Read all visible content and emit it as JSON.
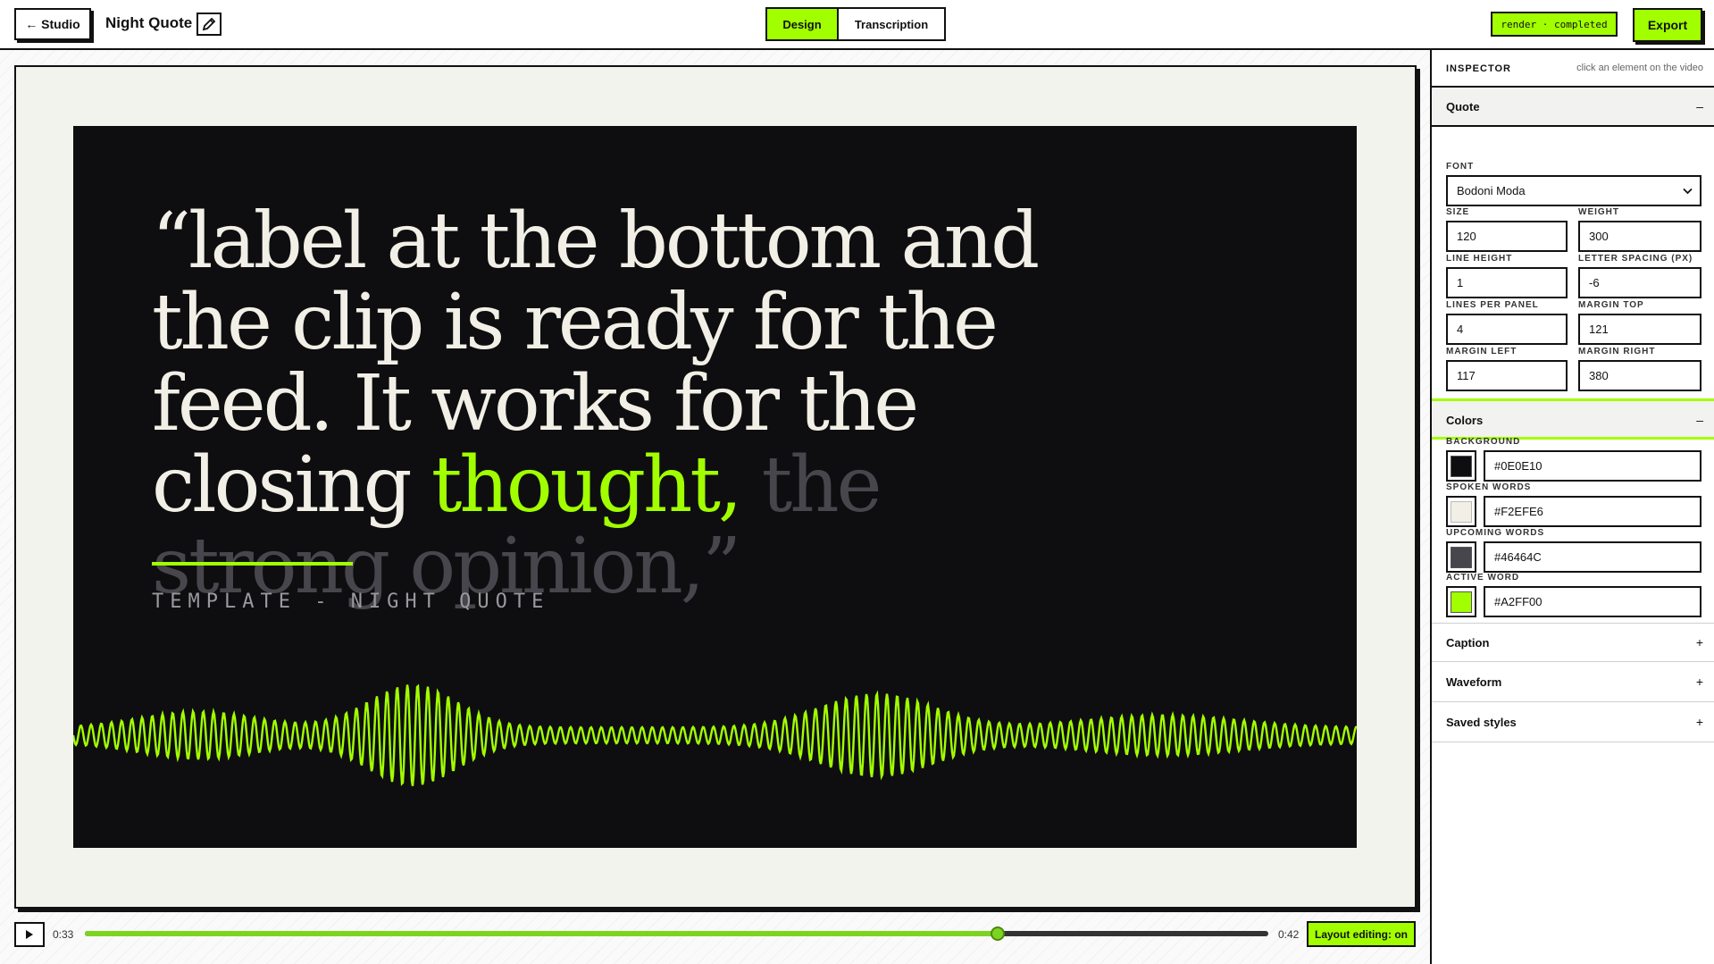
{
  "topbar": {
    "back_label": "← Studio",
    "project_name": "Night Quote",
    "modes": [
      "Design",
      "Transcription"
    ],
    "active_mode": "Design",
    "render_status": "render · completed",
    "export_label": "Export"
  },
  "video": {
    "quote_open": "“",
    "quote_spoken": "label at the bottom and the clip is ready for the feed. It works for the closing ",
    "quote_active": "thought,",
    "quote_upcoming": " the strong opinion,",
    "quote_close": "”",
    "caption": "TEMPLATE - NIGHT QUOTE"
  },
  "player": {
    "current_time": "0:33",
    "duration": "0:42",
    "progress": 0.771,
    "layout_label": "Layout editing: on"
  },
  "inspector": {
    "title": "INSPECTOR",
    "hint": "click an element on the video",
    "quote_section": {
      "label": "Quote",
      "sign": "–",
      "font_label": "FONT",
      "font_value": "Bodoni Moda",
      "size_label": "SIZE",
      "size_value": "120",
      "weight_label": "WEIGHT",
      "weight_value": "300",
      "line_height_label": "LINE HEIGHT",
      "line_height_value": "1",
      "letter_spacing_label": "LETTER SPACING (PX)",
      "letter_spacing_value": "-6",
      "lines_per_panel_label": "LINES PER PANEL",
      "lines_per_panel_value": "4",
      "margin_top_label": "MARGIN TOP",
      "margin_top_value": "121",
      "margin_left_label": "MARGIN LEFT",
      "margin_left_value": "117",
      "margin_right_label": "MARGIN RIGHT",
      "margin_right_value": "380"
    },
    "colors_section": {
      "label": "Colors",
      "sign": "–",
      "background_label": "BACKGROUND",
      "background_value": "#0E0E10",
      "spoken_label": "SPOKEN WORDS",
      "spoken_value": "#F2EFE6",
      "upcoming_label": "UPCOMING WORDS",
      "upcoming_value": "#46464C",
      "active_label": "ACTIVE WORD",
      "active_value": "#A2FF00"
    },
    "collapsed_sections": [
      {
        "label": "Caption",
        "sign": "+"
      },
      {
        "label": "Waveform",
        "sign": "+"
      },
      {
        "label": "Saved styles",
        "sign": "+"
      }
    ]
  },
  "colors": {
    "accent": "#A2FF00",
    "background": "#0E0E10",
    "spoken": "#F2EFE6",
    "upcoming": "#46464C",
    "progress": "#7ED321"
  }
}
